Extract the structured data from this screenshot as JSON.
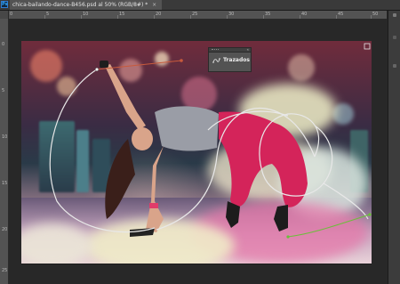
{
  "app": {
    "icon_label": "Ps"
  },
  "document_tab": {
    "title": "chica-bailando-dance-B456.psd al 50% (RGB/8#) *",
    "close_glyph": "×"
  },
  "ruler_h_labels": [
    "0",
    "5",
    "10",
    "15",
    "20",
    "25",
    "30",
    "35",
    "40",
    "45",
    "50"
  ],
  "ruler_v_labels": [
    "0",
    "5",
    "10",
    "15",
    "20",
    "25"
  ],
  "paths_panel": {
    "title": "Trazados",
    "collapse_glyph": "«",
    "icon": "paths-icon"
  },
  "canvas": {
    "subject": "dancer-on-clouds-photo"
  },
  "colors": {
    "workspace": "#282828",
    "tab_active": "#535353",
    "ruler": "#535353",
    "path_stroke": "#e8e8e8",
    "anchor_accent": "#c85a3c",
    "green_point": "#6bbf3a"
  }
}
